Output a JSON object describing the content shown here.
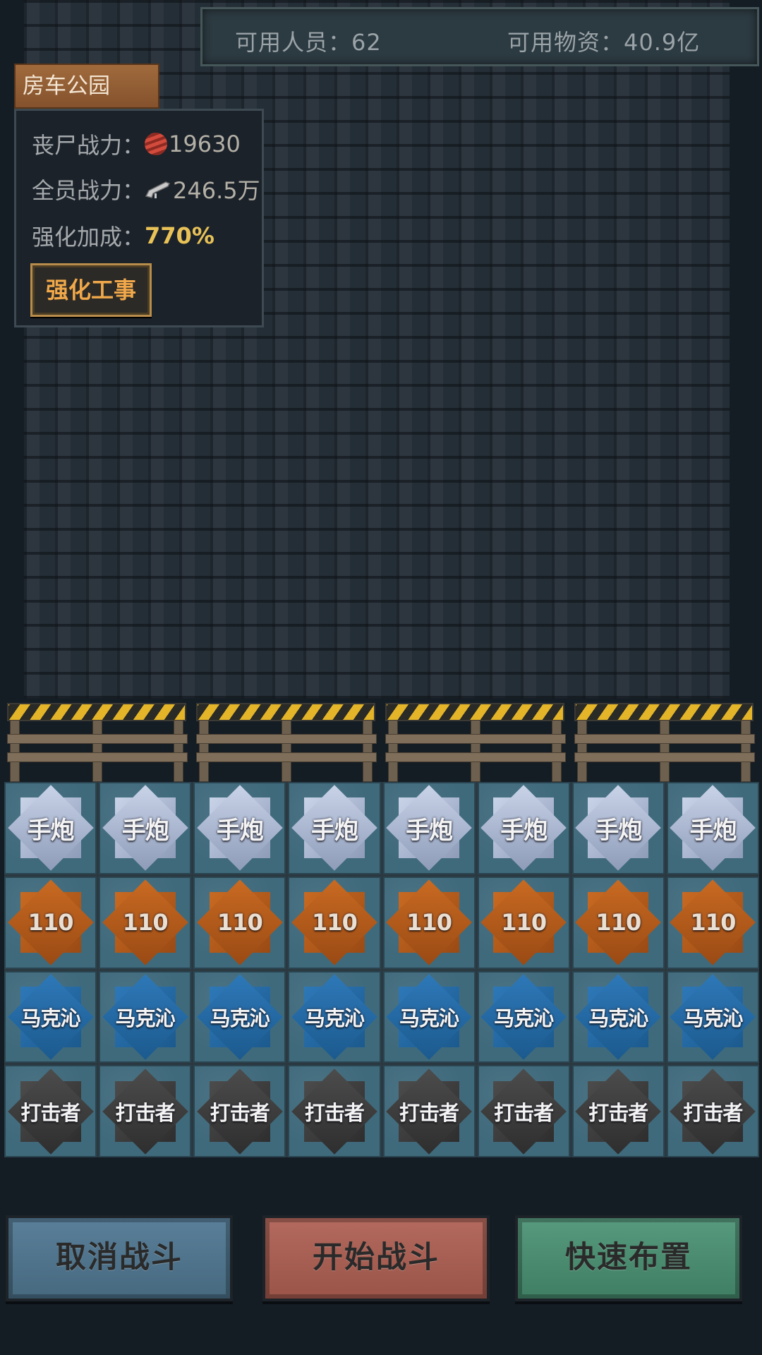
{
  "header": {
    "available_people": "可用人员：62",
    "available_supplies": "可用物资：40.9亿"
  },
  "location": {
    "name": "房车公园"
  },
  "info": {
    "zombie_power_label": "丧尸战力：",
    "zombie_power_value": "19630",
    "team_power_label": "全员战力：",
    "team_power_value": "246.5万",
    "boost_label": "强化加成：",
    "boost_value": "770%",
    "upgrade_button": "强化工事"
  },
  "barricades": {
    "count": 4
  },
  "unit_rows": [
    {
      "tier": "silver",
      "labels": [
        "手炮",
        "手炮",
        "手炮",
        "手炮",
        "手炮",
        "手炮",
        "手炮",
        "手炮"
      ]
    },
    {
      "tier": "bronze",
      "labels": [
        "110",
        "110",
        "110",
        "110",
        "110",
        "110",
        "110",
        "110"
      ]
    },
    {
      "tier": "blue",
      "labels": [
        "马克沁",
        "马克沁",
        "马克沁",
        "马克沁",
        "马克沁",
        "马克沁",
        "马克沁",
        "马克沁"
      ]
    },
    {
      "tier": "dark",
      "labels": [
        "打击者",
        "打击者",
        "打击者",
        "打击者",
        "打击者",
        "打击者",
        "打击者",
        "打击者"
      ]
    }
  ],
  "actions": {
    "cancel": "取消战斗",
    "start": "开始战斗",
    "quick": "快速布置"
  },
  "colors": {
    "background": "#141c24",
    "accent_gold": "#e9c257",
    "button_cancel": "#4f7590",
    "button_start": "#a85e52",
    "button_quick": "#4a8c70"
  }
}
